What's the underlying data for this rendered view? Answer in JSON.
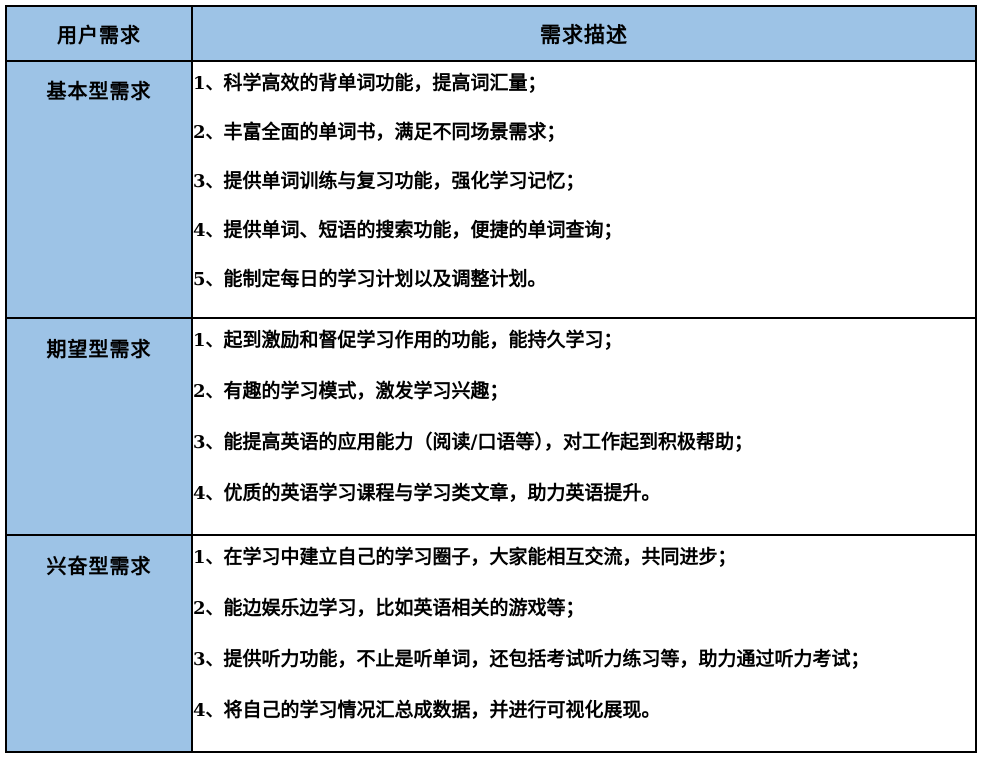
{
  "table": {
    "header": {
      "label_column": "用户需求",
      "description_column": "需求描述"
    },
    "rows": [
      {
        "category": "基本型需求",
        "items": [
          {
            "num": "1、",
            "text": "科学高效的背单词功能，提高词汇量；"
          },
          {
            "num": "2、",
            "text": "丰富全面的单词书，满足不同场景需求；"
          },
          {
            "num": "3、",
            "text": "提供单词训练与复习功能，强化学习记忆；"
          },
          {
            "num": "4、",
            "text": "提供单词、短语的搜索功能，便捷的单词查询；"
          },
          {
            "num": "5、",
            "text": "能制定每日的学习计划以及调整计划。"
          }
        ]
      },
      {
        "category": "期望型需求",
        "items": [
          {
            "num": "1、",
            "text": "起到激励和督促学习作用的功能，能持久学习；"
          },
          {
            "num": "2、",
            "text": "有趣的学习模式，激发学习兴趣；"
          },
          {
            "num": "3、",
            "text": "能提高英语的应用能力（阅读/口语等），对工作起到积极帮助；"
          },
          {
            "num": "4、",
            "text": "优质的英语学习课程与学习类文章，助力英语提升。"
          }
        ]
      },
      {
        "category": "兴奋型需求",
        "items": [
          {
            "num": "1、",
            "text": "在学习中建立自己的学习圈子，大家能相互交流，共同进步；"
          },
          {
            "num": "2、",
            "text": "能边娱乐边学习，比如英语相关的游戏等；"
          },
          {
            "num": "3、",
            "text": "提供听力功能，不止是听单词，还包括考试听力练习等，助力通过听力考试；"
          },
          {
            "num": "4、",
            "text": "将自己的学习情况汇总成数据，并进行可视化展现。"
          }
        ]
      }
    ]
  },
  "colors": {
    "header_fill": "#9DC3E6",
    "category_fill": "#9DC3E6",
    "border": "#000000",
    "text": "#000000",
    "body_background": "#FFFFFF"
  }
}
